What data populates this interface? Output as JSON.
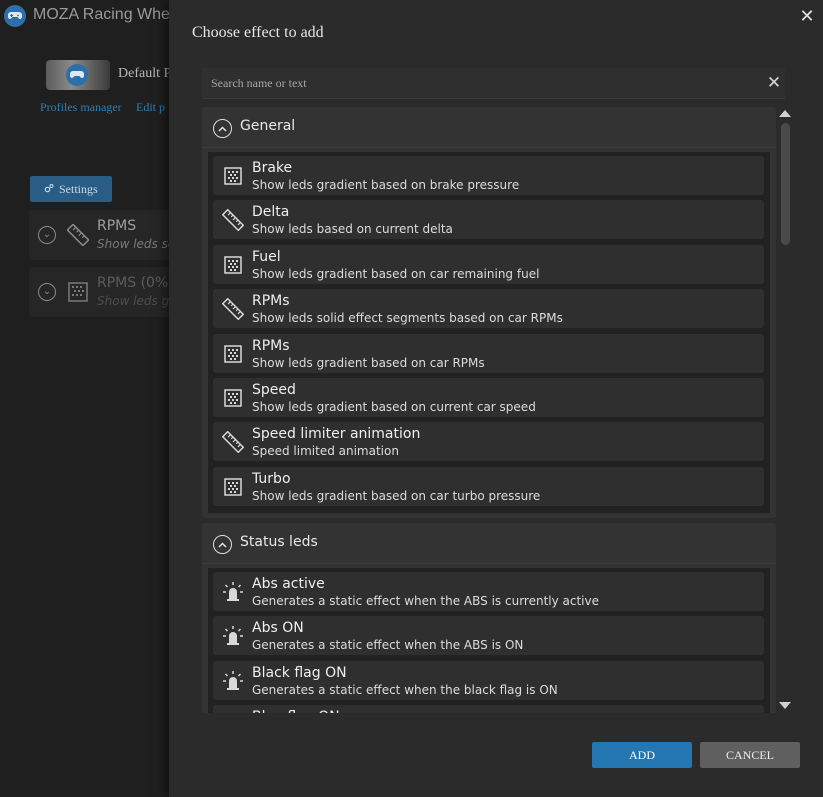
{
  "app": {
    "title": "MOZA Racing Wheel",
    "profile_name": "Default P",
    "profiles_manager_link": "Profiles manager",
    "edit_profile_link": "Edit p",
    "settings_button": "Settings",
    "effects": [
      {
        "name": "RPMS",
        "description": "Show leds so",
        "icon": "ruler-icon"
      },
      {
        "name": "RPMS (0%",
        "description": "Show leds gr",
        "icon": "gradient-icon"
      }
    ]
  },
  "dialog": {
    "title": "Choose effect to add",
    "search": {
      "placeholder": "Search name or text",
      "value": ""
    },
    "sections": [
      {
        "title": "General",
        "items": [
          {
            "name": "Brake",
            "description": "Show leds gradient based on brake pressure",
            "icon": "gradient-icon"
          },
          {
            "name": "Delta",
            "description": "Show leds based on current delta",
            "icon": "ruler-icon"
          },
          {
            "name": "Fuel",
            "description": "Show leds gradient based on car remaining fuel",
            "icon": "gradient-icon"
          },
          {
            "name": "RPMs",
            "description": "Show leds solid effect segments based on car RPMs",
            "icon": "ruler-icon"
          },
          {
            "name": "RPMs",
            "description": "Show leds gradient based on car RPMs",
            "icon": "gradient-icon"
          },
          {
            "name": "Speed",
            "description": "Show leds gradient based on current car speed",
            "icon": "gradient-icon"
          },
          {
            "name": "Speed limiter animation",
            "description": "Speed limited animation",
            "icon": "ruler-icon"
          },
          {
            "name": "Turbo",
            "description": "Show leds gradient based on car turbo pressure",
            "icon": "gradient-icon"
          }
        ]
      },
      {
        "title": "Status leds",
        "items": [
          {
            "name": "Abs active",
            "description": "Generates a static effect when the ABS is currently active",
            "icon": "led-icon"
          },
          {
            "name": "Abs ON",
            "description": "Generates a static effect when the ABS is ON",
            "icon": "led-icon"
          },
          {
            "name": "Black flag ON",
            "description": "Generates a static effect when the black flag is ON",
            "icon": "led-icon"
          },
          {
            "name": "Blue flag ON",
            "description": "",
            "icon": "led-icon"
          }
        ]
      }
    ],
    "add_button": "ADD",
    "cancel_button": "CANCEL"
  },
  "colors": {
    "accent": "#2476b0",
    "cancel": "#5f5f5f",
    "background": "#2b2b2b"
  }
}
